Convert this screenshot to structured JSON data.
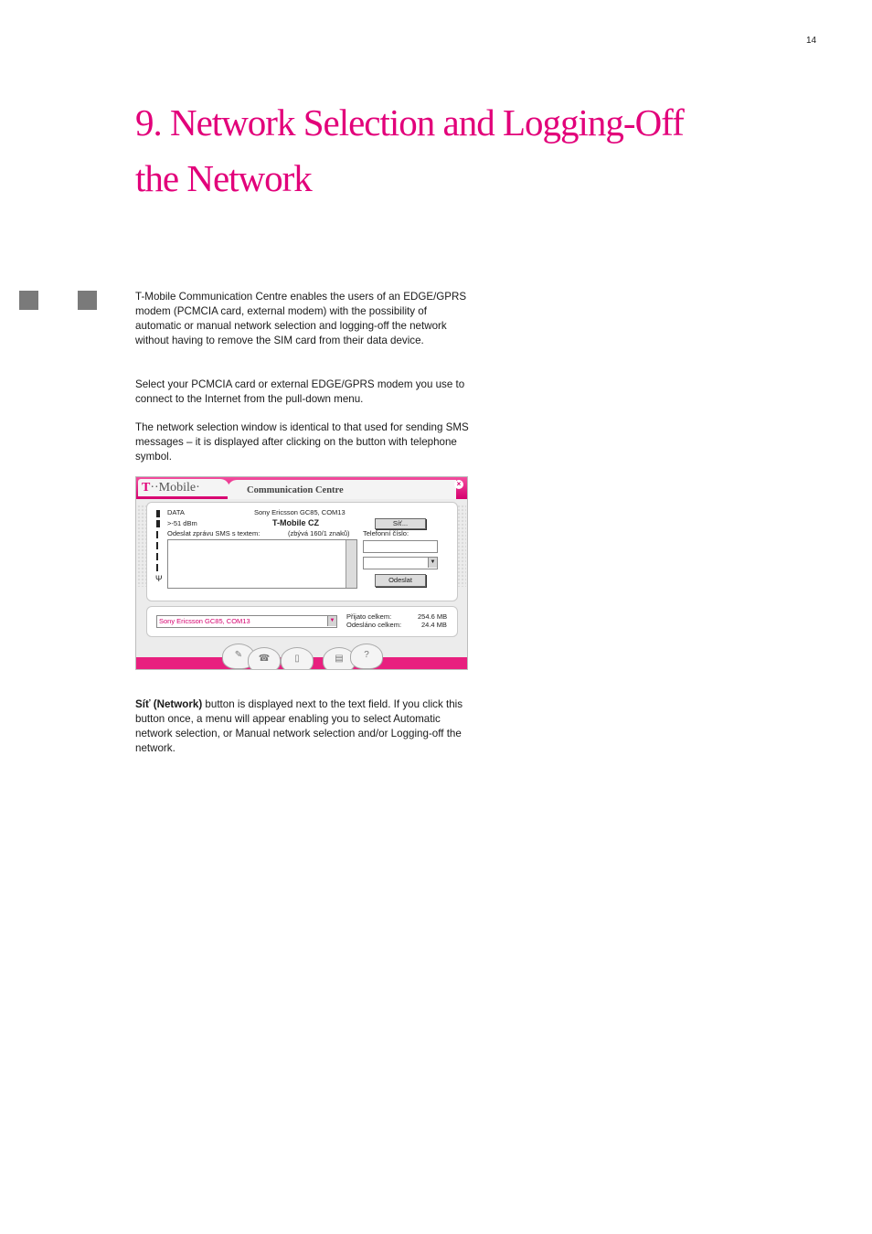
{
  "page_number": "14",
  "title_line1": "9. Network Selection and Logging-Off",
  "title_line2": "the Network",
  "paragraphs": {
    "p1": "T-Mobile Communication Centre enables the users of an EDGE/GPRS modem (PCMCIA card, external modem) with the possibility of automatic or manual network selection and logging-off the network without having to remove the SIM card from their data device.",
    "p2": "Select your PCMCIA card or external EDGE/GPRS modem you use to connect to the Internet from the pull-down menu.",
    "p3": "The network selection window is identical to that used for sending SMS messages – it is displayed after clicking on the button with telephone symbol.",
    "p4_bold": "Síť (Network)",
    "p4_rest": " button is displayed next to the text field. If you click this button once, a menu will appear enabling you to select Automatic network selection, or Manual network selection and/or Logging-off the network."
  },
  "app": {
    "logo_t": "T",
    "logo_rest": "··Mobile·",
    "title": "Communication Centre",
    "close": "×",
    "mode": "DATA",
    "device": "Sony Ericsson GC85, COM13",
    "signal": ">-51 dBm",
    "operator": "T-Mobile CZ",
    "network_button": "Síť...",
    "sms_label": "Odeslat zprávu SMS s textem:",
    "remaining": "(zbývá 160/1 znaků)",
    "phone_label": "Telefonní číslo:",
    "send_button": "Odeslat",
    "device_select": "Sony Ericsson GC85, COM13",
    "received_label": "Přijato celkem:",
    "received_value": "254.6 MB",
    "sent_label": "Odesláno celkem:",
    "sent_value": "24.4 MB",
    "nav_icons": [
      "wrench-icon",
      "phone-icon",
      "mobile-icon",
      "lock-icon",
      "help-icon"
    ],
    "nav_glyphs": [
      "✎",
      "☎",
      "▯",
      "▤",
      "?"
    ]
  }
}
